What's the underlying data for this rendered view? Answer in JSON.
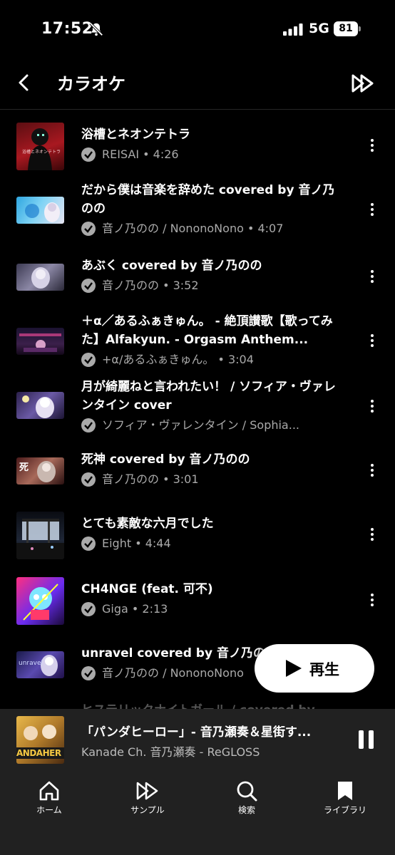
{
  "status": {
    "time": "17:52",
    "network": "5G",
    "battery": "81"
  },
  "header": {
    "title": "カラオケ"
  },
  "tracks": [
    {
      "title": "浴槽とネオンテトラ",
      "sub": "REISAI • 4:26"
    },
    {
      "title": "だから僕は音楽を辞めた covered by 音ノ乃のの",
      "sub": "音ノ乃のの / NononoNono  • 4:07"
    },
    {
      "title": "あぶく covered by 音ノ乃のの",
      "sub": "音ノ乃のの • 3:52"
    },
    {
      "title": "＋α／あるふぁきゅん。 - 絶頂讃歌【歌ってみた】Alfakyun. - Orgasm Anthem...",
      "sub": "+α/あるふぁきゅん。 • 3:04"
    },
    {
      "title": "月が綺麗ねと言われたい！ / ソフィア・ヴァレンタイン cover",
      "sub": "ソフィア・ヴァレンタイン / Sophia..."
    },
    {
      "title": "死神 covered by 音ノ乃のの",
      "sub": "音ノ乃のの • 3:01"
    },
    {
      "title": "とても素敵な六月でした",
      "sub": "Eight • 4:44"
    },
    {
      "title": "CH4NGE (feat. 可不)",
      "sub": "Giga • 2:13"
    },
    {
      "title": "unravel covered by 音ノ乃のの",
      "sub": "音ノ乃のの / NononoNono"
    }
  ],
  "faded_next": "ヒステリックナイトガール / covered by",
  "play_button": {
    "label": "再生"
  },
  "now_playing": {
    "title": "「パンダヒーロー」- 音乃瀬奏＆星街す...",
    "artist": "Kanade Ch. 音乃瀬奏 - ReGLOSS",
    "thumb_text": "ANDAHER"
  },
  "thumb_texts": {
    "t1": "浴槽とネオンテトラ",
    "t6": "死",
    "t9": "unravel"
  },
  "nav": [
    {
      "label": "ホーム",
      "icon": "home-icon"
    },
    {
      "label": "サンプル",
      "icon": "samples-icon"
    },
    {
      "label": "検索",
      "icon": "search-icon"
    },
    {
      "label": "ライブラリ",
      "icon": "library-icon"
    }
  ]
}
